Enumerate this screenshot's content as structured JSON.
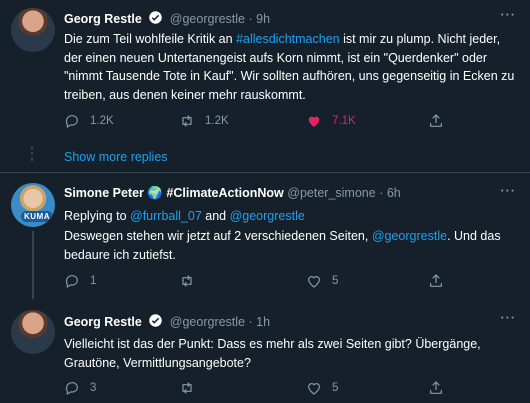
{
  "tweets": [
    {
      "name": "Georg Restle",
      "handle": "@georgrestle",
      "time": "· 9h",
      "text_before": "Die zum Teil wohlfeile Kritik an ",
      "hashtag": "#allesdichtmachen",
      "text_after": " ist mir zu plump. Nicht jeder, der einen neuen Untertanengeist aufs Korn nimmt, ist ein \"Querdenker\" oder \"nimmt Tausende Tote in Kauf\". Wir sollten aufhören, uns gegenseitig in Ecken zu treiben, aus denen keiner mehr rauskommt.",
      "replies": "1.2K",
      "retweets": "1.2K",
      "likes": "7.1K"
    },
    {
      "name": "Simone Peter 🌍 #ClimateActionNow",
      "handle": "@peter_simone",
      "time": "· 6h",
      "avatar_badge": "KUMA",
      "replying_prefix": "Replying to ",
      "replying_user1": "@furrball_07",
      "replying_and": " and ",
      "replying_user2": "@georgrestle",
      "text_before": "Deswegen stehen wir jetzt auf 2 verschiedenen Seiten, ",
      "mention": "@georgrestle",
      "text_after": ". Und das bedaure ich zutiefst.",
      "replies": "1",
      "retweets": "",
      "likes": "5"
    },
    {
      "name": "Georg Restle",
      "handle": "@georgrestle",
      "time": "· 1h",
      "text": "Vielleicht ist das der Punkt: Dass es mehr als zwei Seiten gibt? Übergänge, Grautöne, Vermittlungsangebote?",
      "replies": "3",
      "retweets": "",
      "likes": "5"
    }
  ],
  "show_more": "Show more replies",
  "colors": {
    "background": "#15202b",
    "link": "#1da1f2",
    "muted": "#8899a6",
    "like_active": "#e0245e",
    "divider": "#38444d"
  }
}
